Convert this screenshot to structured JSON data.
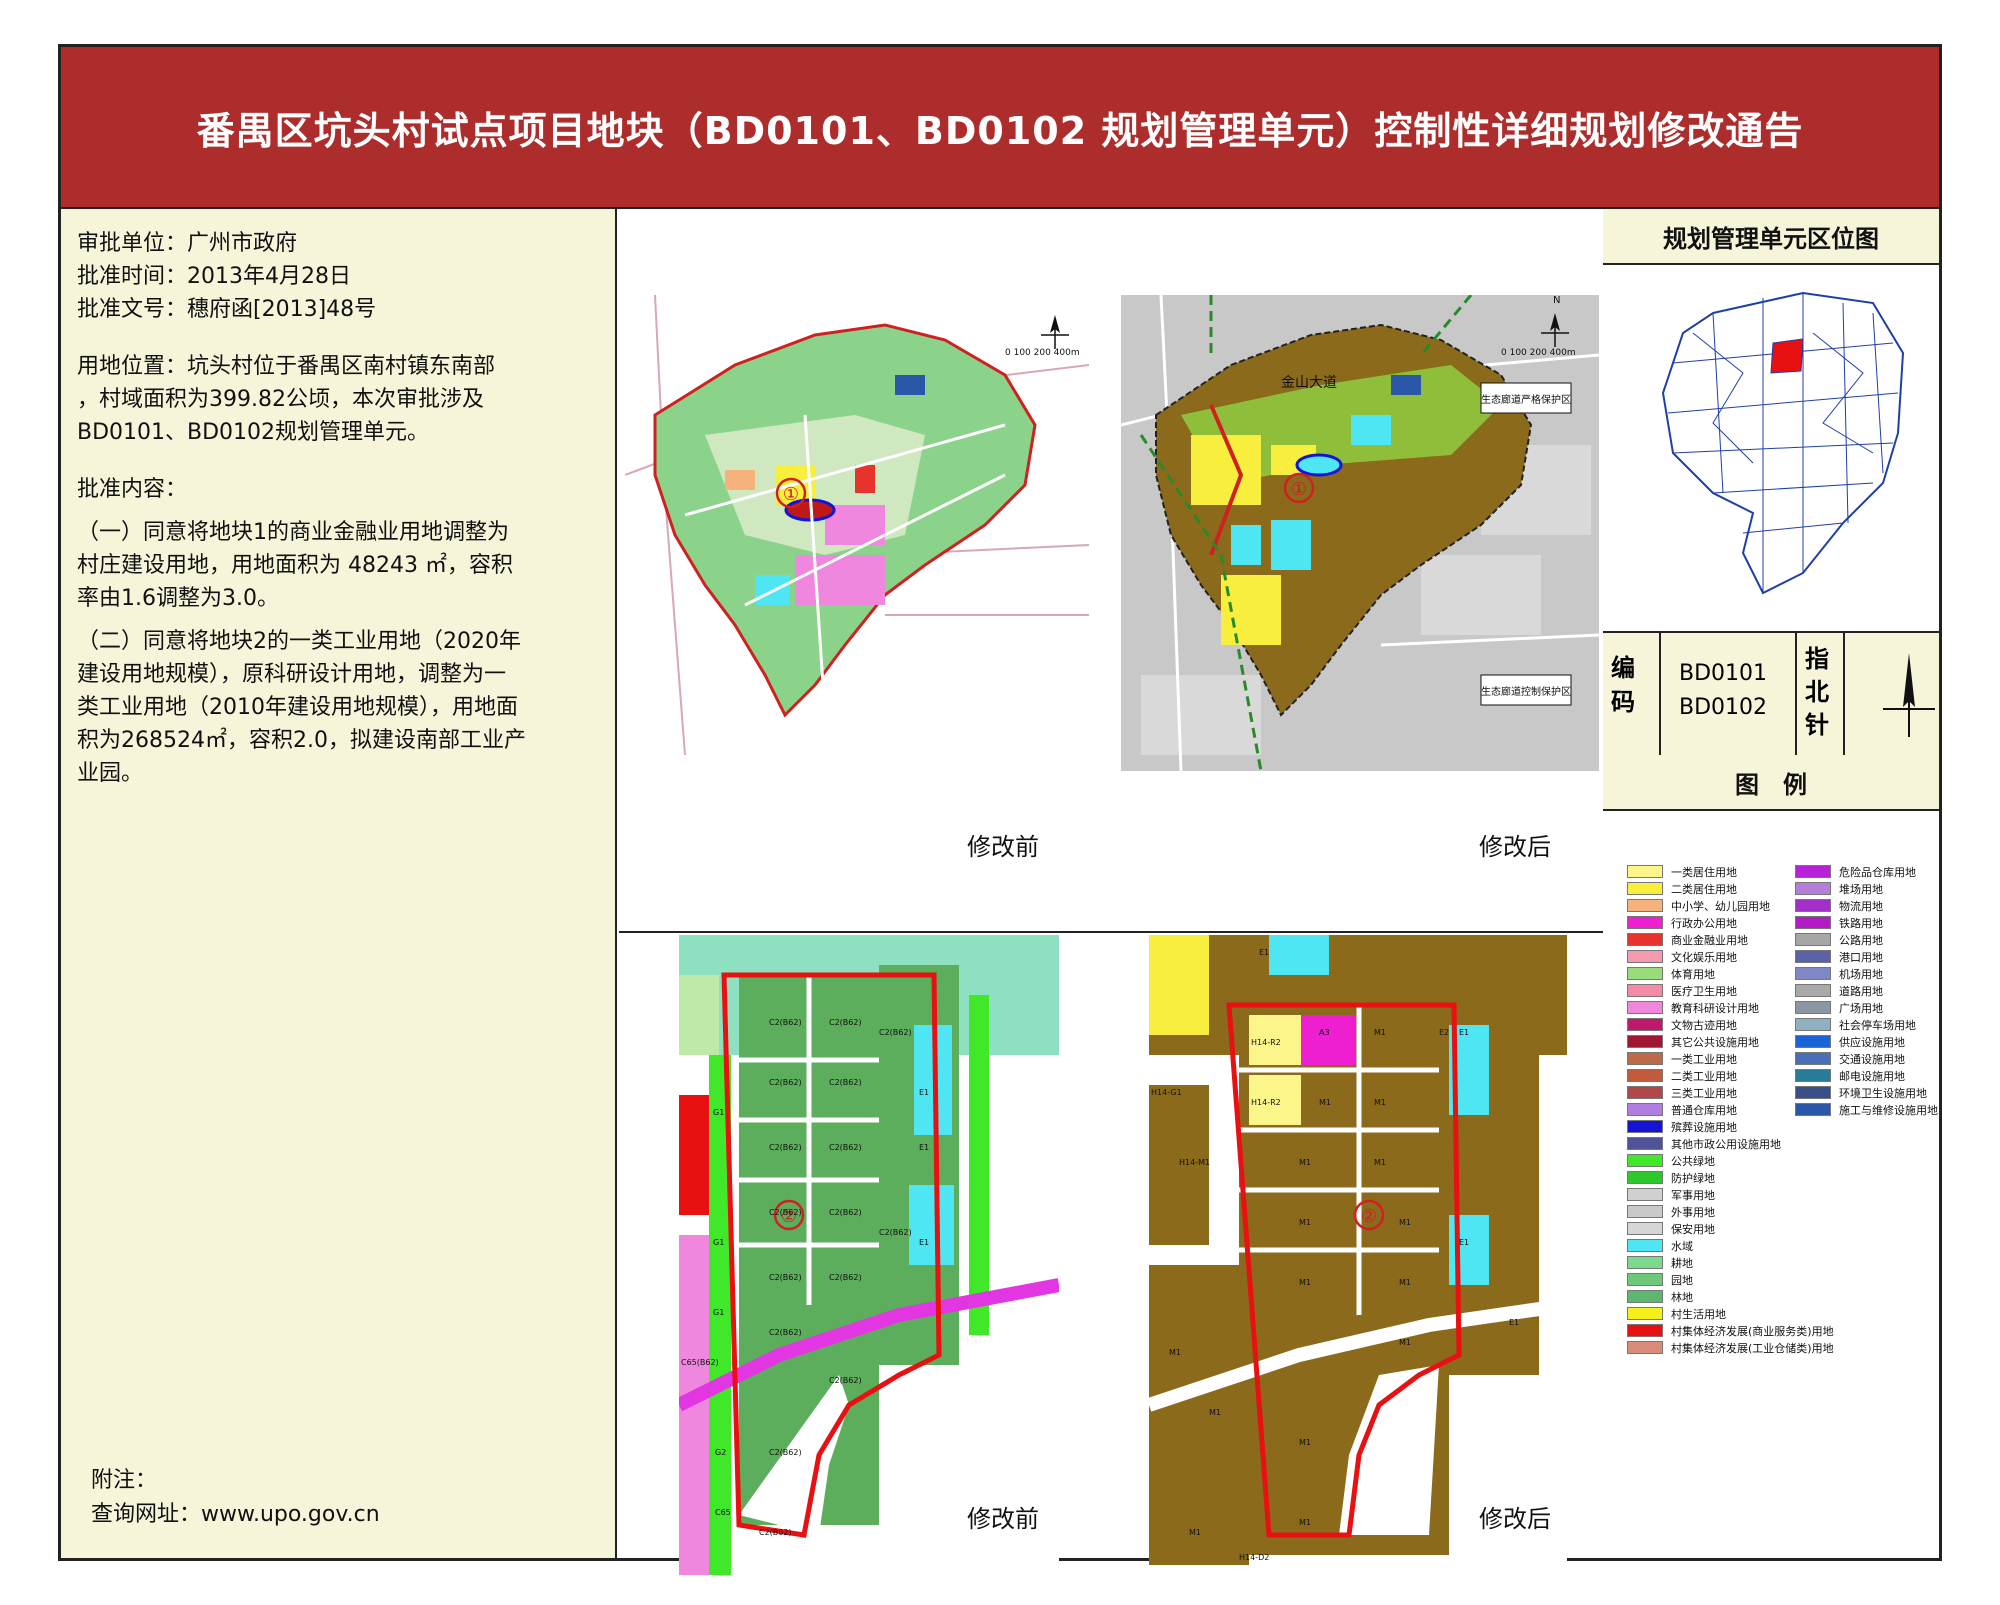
{
  "title": "番禺区坑头村试点项目地块（BD0101、BD0102 规划管理单元）控制性详细规划修改通告",
  "info": {
    "approver": "审批单位：广州市政府",
    "date": "批准时间：2013年4月28日",
    "docno": "批准文号：穗府函[2013]48号",
    "location": [
      "用地位置：坑头村位于番禺区南村镇东南部",
      "，村域面积为399.82公顷，本次审批涉及",
      "BD0101、BD0102规划管理单元。"
    ],
    "content_head": "批准内容：",
    "item1": [
      "（一）同意将地块1的商业金融业用地调整为",
      "村庄建设用地，用地面积为 48243 ㎡，容积",
      "率由1.6调整为3.0。"
    ],
    "item2": [
      "（二）同意将地块2的一类工业用地（2020年",
      "建设用地规模），原科研设计用地，调整为一",
      "类工业用地（2010年建设用地规模），用地面",
      "积为268524㎡，容积2.0，拟建设南部工业产",
      "业园。"
    ],
    "note_head": "附注：",
    "note_url": "查询网址：www.upo.gov.cn"
  },
  "maps": {
    "before": "修改前",
    "after": "修改后",
    "plot1_marker": "①",
    "plot2_marker": "②",
    "scale": "0 100 200   400m",
    "north_n": "N",
    "road_label": "金山大道",
    "zone_label_1": "生态廊道严格保护区",
    "zone_label_2": "生态廊道控制保护区",
    "before_codes": [
      "C2(B62)",
      "C2(B62)",
      "C2(B62)",
      "C2(B62)",
      "C2(B62)",
      "C2(B62)",
      "C2(B62)",
      "C2(B62)",
      "C2(B62)",
      "C2(B62)",
      "C2(B62)",
      "C2(B62)",
      "C2(B62)",
      "C2(B62)",
      "C2(B62)",
      "C2(B62)",
      "G1",
      "G1",
      "G1",
      "E1",
      "E1",
      "E1",
      "C65(B62)",
      "C65",
      "G2"
    ],
    "after_codes": [
      "E1",
      "E1",
      "E2",
      "E1",
      "H14-R2",
      "A3",
      "M1",
      "H14-R2",
      "M1",
      "M1",
      "H14-G1",
      "M1",
      "M1",
      "H14-M1",
      "M1",
      "M1",
      "M1",
      "M1",
      "M1",
      "M1",
      "M1",
      "M1",
      "M1",
      "M1",
      "E1",
      "H14-D2"
    ]
  },
  "right": {
    "location_title": "规划管理单元区位图",
    "code_label": "编码",
    "codes": [
      "BD0101",
      "BD0102"
    ],
    "north_label": "指北针",
    "legend_title": "图　例",
    "legend_left": [
      {
        "label": "一类居住用地",
        "color": "#fbf58a"
      },
      {
        "label": "二类居住用地",
        "color": "#f7ee3d"
      },
      {
        "label": "中小学、幼儿园用地",
        "color": "#f6b27b"
      },
      {
        "label": "行政办公用地",
        "color": "#ed1fd0"
      },
      {
        "label": "商业金融业用地",
        "color": "#e8332c"
      },
      {
        "label": "文化娱乐用地",
        "color": "#f59bb0"
      },
      {
        "label": "体育用地",
        "color": "#9bdc7a"
      },
      {
        "label": "医疗卫生用地",
        "color": "#f48aa3"
      },
      {
        "label": "教育科研设计用地",
        "color": "#ee87dd"
      },
      {
        "label": "文物古迹用地",
        "color": "#c0196b"
      },
      {
        "label": "其它公共设施用地",
        "color": "#a01634"
      },
      {
        "label": "一类工业用地",
        "color": "#bd6a49"
      },
      {
        "label": "二类工业用地",
        "color": "#c25a3d"
      },
      {
        "label": "三类工业用地",
        "color": "#b2474a"
      },
      {
        "label": "普通仓库用地",
        "color": "#b07ee0"
      },
      {
        "label": "殡葬设施用地",
        "color": "#1414d4"
      },
      {
        "label": "其他市政公用设施用地",
        "color": "#4f5398"
      },
      {
        "label": "公共绿地",
        "color": "#40e829"
      },
      {
        "label": "防护绿地",
        "color": "#2cc82c"
      },
      {
        "label": "军事用地",
        "color": "#d0d0d0"
      },
      {
        "label": "外事用地",
        "color": "#c9c9c9"
      },
      {
        "label": "保安用地",
        "color": "#d6d6d6"
      },
      {
        "label": "水域",
        "color": "#4de6f2"
      },
      {
        "label": "耕地",
        "color": "#7cda8c"
      },
      {
        "label": "园地",
        "color": "#6ec87a"
      },
      {
        "label": "林地",
        "color": "#5cb870"
      },
      {
        "label": "村生活用地",
        "color": "#f6f01a"
      },
      {
        "label": "村集体经济发展(商业服务类)用地",
        "color": "#e81010"
      },
      {
        "label": "村集体经济发展(工业仓储类)用地",
        "color": "#d78b78"
      }
    ],
    "legend_right": [
      {
        "label": "危险品仓库用地",
        "color": "#b722d8"
      },
      {
        "label": "堆场用地",
        "color": "#b57ed8"
      },
      {
        "label": "物流用地",
        "color": "#a32fc9"
      },
      {
        "label": "铁路用地",
        "color": "#b51ac7"
      },
      {
        "label": "公路用地",
        "color": "#a6a6a6"
      },
      {
        "label": "港口用地",
        "color": "#5a63a8"
      },
      {
        "label": "机场用地",
        "color": "#7f88c5"
      },
      {
        "label": "道路用地",
        "color": "#a9a9a9"
      },
      {
        "label": "广场用地",
        "color": "#8d96a3"
      },
      {
        "label": "社会停车场用地",
        "color": "#8fb1bf"
      },
      {
        "label": "供应设施用地",
        "color": "#1a64d6"
      },
      {
        "label": "交通设施用地",
        "color": "#4b6fb7"
      },
      {
        "label": "邮电设施用地",
        "color": "#2a7a9a"
      },
      {
        "label": "环境卫生设施用地",
        "color": "#3a4f8a"
      },
      {
        "label": "施工与维修设施用地",
        "color": "#2b57a8"
      }
    ]
  }
}
